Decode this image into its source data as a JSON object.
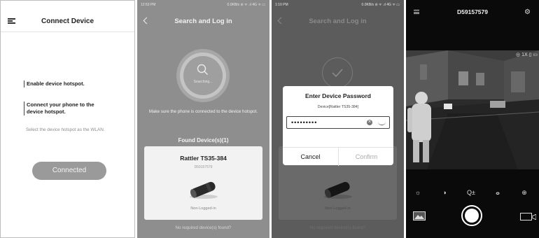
{
  "screen1": {
    "title": "Connect Device",
    "steps": [
      "Enable device hotspot.",
      "Connect your phone to the device hotspot."
    ],
    "hint": "Select the device hotspot as the WLAN.",
    "button_label": "Connected",
    "icons": {
      "menu": "hamburger-menu-icon"
    }
  },
  "screen2": {
    "status_time": "12:53 PM",
    "status_right": "0.0KB/s ⊘ ᯤ .ıl 4G ᯤ ▭",
    "title": "Search and Log in",
    "search_label": "Searching...",
    "note": "Make sure the phone is connected to the device hotspot.",
    "found_title": "Found Device(s)(1)",
    "device_name": "Rattler TS35-384",
    "device_serial": "D59157579",
    "device_status": "Non-Logged-in",
    "footer_link": "No required device(s) found?",
    "icons": {
      "back": "back-arrow-icon",
      "search": "search-icon"
    }
  },
  "screen3": {
    "status_time": "1:10 PM",
    "status_right": "0.0KB/s ⊘ ᯤ .ıl 4G ᯤ ▭",
    "title": "Search and Log in",
    "dialog_title": "Enter Device Password",
    "dialog_device": "Device[Rattler TS35-384]",
    "password_value": "•••••••••",
    "cancel_label": "Cancel",
    "confirm_label": "Confirm",
    "background_device_status": "Non-Logged-in",
    "background_footer": "No required device(s) found?",
    "icons": {
      "clear": "clear-icon",
      "eye": "hide-password-icon",
      "check": "checkmark-icon"
    }
  },
  "screen4": {
    "title": "D59157579",
    "overlay": "◎ 1X ▯ ▭",
    "controls": [
      "☼",
      "◑",
      "Q±",
      "ⴰ",
      "⊕"
    ],
    "icons": {
      "settings": "gear-icon",
      "gallery": "gallery-icon",
      "shutter": "shutter-icon",
      "record": "video-record-icon"
    }
  }
}
